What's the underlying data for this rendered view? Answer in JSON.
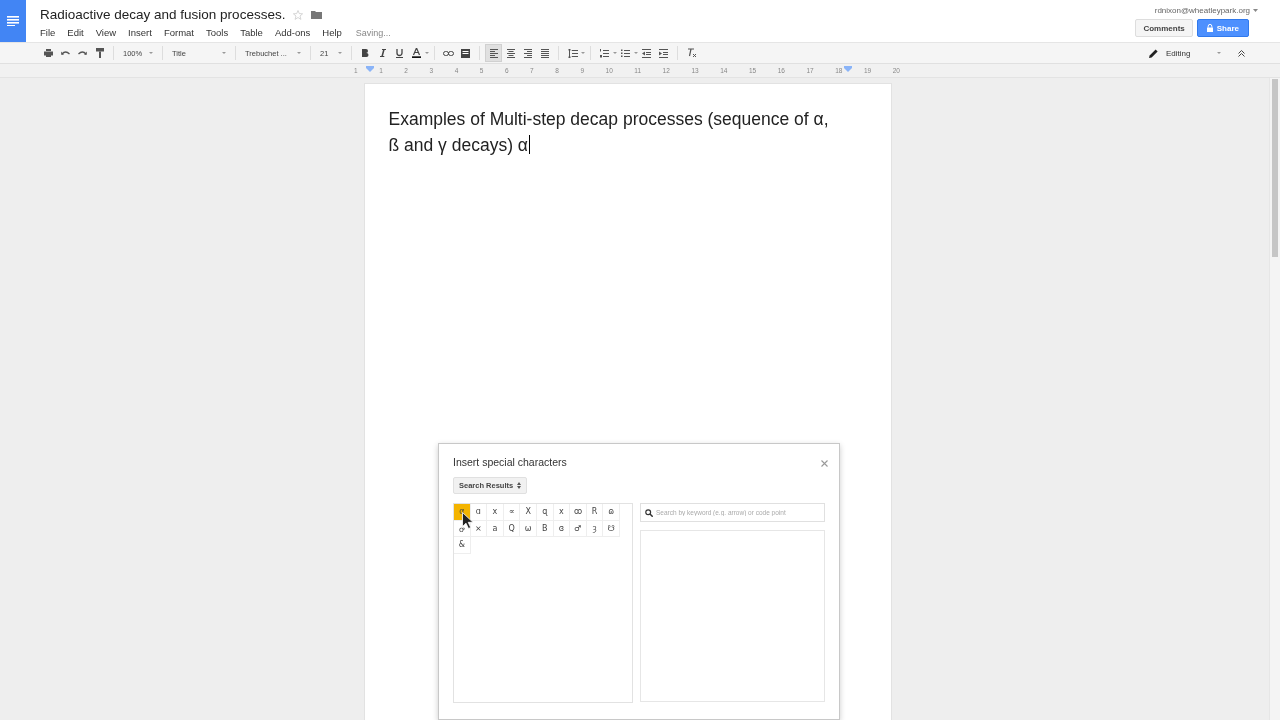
{
  "document": {
    "title": "Radioactive decay and fusion processes.",
    "starred": false
  },
  "menu": [
    "File",
    "Edit",
    "View",
    "Insert",
    "Format",
    "Tools",
    "Table",
    "Add-ons",
    "Help"
  ],
  "save_status": "Saving...",
  "account": {
    "email": "rdnixon@wheatleypark.org"
  },
  "header_buttons": {
    "comments": "Comments",
    "share": "Share"
  },
  "toolbar": {
    "zoom": "100%",
    "style": "Title",
    "font": "Trebuchet ...",
    "size": "21",
    "alignment": [
      {
        "kind": "left",
        "selected": true
      },
      {
        "kind": "center",
        "selected": false
      },
      {
        "kind": "right",
        "selected": false
      },
      {
        "kind": "justify",
        "selected": false
      }
    ],
    "mode": "Editing"
  },
  "ruler": [
    "1",
    "1",
    "2",
    "3",
    "4",
    "5",
    "6",
    "7",
    "8",
    "9",
    "10",
    "11",
    "12",
    "13",
    "14",
    "15",
    "16",
    "17",
    "18",
    "19",
    "20"
  ],
  "body": {
    "lines": [
      "Examples of Multi-step decap processes (sequence of α,",
      "ß and γ decays) α"
    ]
  },
  "dialog": {
    "title": "Insert special characters",
    "category": "Search Results",
    "characters": [
      {
        "char": "α",
        "selected": true
      },
      {
        "char": "ɑ",
        "selected": false
      },
      {
        "char": "x",
        "selected": false
      },
      {
        "char": "∝",
        "selected": false
      },
      {
        "char": "X",
        "selected": false
      },
      {
        "char": "ɋ",
        "selected": false
      },
      {
        "char": "x",
        "selected": false
      },
      {
        "char": "ꝏ",
        "selected": false
      },
      {
        "char": "R",
        "selected": false
      },
      {
        "char": "ɷ",
        "selected": false
      },
      {
        "char": "ꝍ",
        "selected": false
      },
      {
        "char": "⨯",
        "selected": false
      },
      {
        "char": "a",
        "selected": false
      },
      {
        "char": "Q",
        "selected": false
      },
      {
        "char": "ω",
        "selected": false
      },
      {
        "char": "B",
        "selected": false
      },
      {
        "char": "ɞ",
        "selected": false
      },
      {
        "char": "♂",
        "selected": false
      },
      {
        "char": "ȝ",
        "selected": false
      },
      {
        "char": "☋",
        "selected": false
      },
      {
        "char": "&",
        "selected": false
      }
    ],
    "search": {
      "placeholder": "Search by keyword (e.g. arrow) or code point"
    }
  }
}
